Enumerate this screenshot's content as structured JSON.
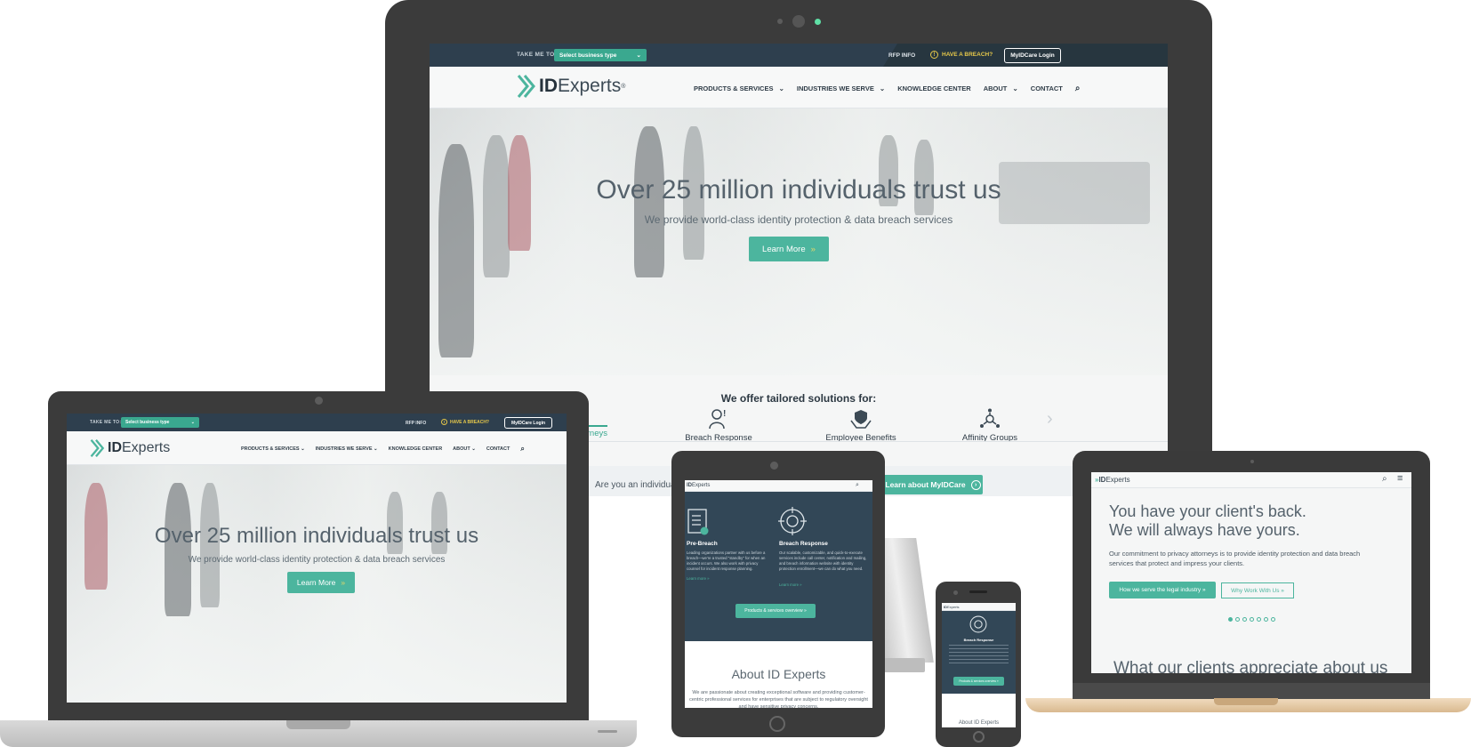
{
  "topbar": {
    "take_me_to": "TAKE ME TO:",
    "select_placeholder": "Select business type",
    "rfp": "RFP INFO",
    "breach": "HAVE A BREACH?",
    "login": "MyIDCare Login"
  },
  "brand": {
    "id": "ID",
    "experts": "Experts",
    "mark": "®"
  },
  "nav": {
    "products": "PRODUCTS & SERVICES",
    "industries": "INDUSTRIES WE SERVE",
    "knowledge": "KNOWLEDGE CENTER",
    "about": "ABOUT",
    "contact": "CONTACT"
  },
  "hero": {
    "title": "Over 25 million individuals trust us",
    "subtitle": "We provide world-class identity protection & data breach services",
    "cta": "Learn More"
  },
  "solutions": {
    "title": "We offer tailored solutions for:",
    "items": [
      {
        "label": "orneys",
        "icon": "gavel-icon"
      },
      {
        "label": "Breach Response",
        "icon": "person-alert-icon"
      },
      {
        "label": "Employee Benefits",
        "icon": "shield-hands-icon"
      },
      {
        "label": "Affinity Groups",
        "icon": "network-icon"
      }
    ],
    "banner_text": "Are you an individua",
    "banner_button": "Learn about MyIDCare"
  },
  "tablet": {
    "pre_title": "Pre-Breach",
    "pre_text": "Leading organizations partner with us before a breach—we're a trusted \"standby\" for when an incident occurs. We also work with privacy counsel for incident response planning.",
    "pre_link": "Learn more »",
    "resp_title": "Breach Response",
    "resp_text": "Our scalable, customizable, and quick-to-execute services include call center, notification and mailing, and breach information website with identity protection enrollment—we can do what you need.",
    "resp_link": "Learn more »",
    "overview_button": "Products & services overview »",
    "about_title": "About ID Experts",
    "about_text": "We are passionate about creating exceptional software and providing customer-centric professional services for enterprises that are subject to regulatory oversight and have sensitive privacy concerns."
  },
  "phone": {
    "resp_title": "Breach Response",
    "button": "Products & services overview »",
    "about_title": "About ID Experts"
  },
  "legal": {
    "headline_1": "You have your client's back.",
    "headline_2": "We will always have yours.",
    "body": "Our commitment to privacy attorneys is to provide identity protection and data breach services that protect and impress your clients.",
    "btn_primary": "How we serve the legal industry »",
    "btn_secondary": "Why Work With Us »",
    "next_heading": "What our clients appreciate about us"
  },
  "colors": {
    "accent": "#4cb59e",
    "navy": "#2e3f4e",
    "warning": "#e6c84a"
  }
}
